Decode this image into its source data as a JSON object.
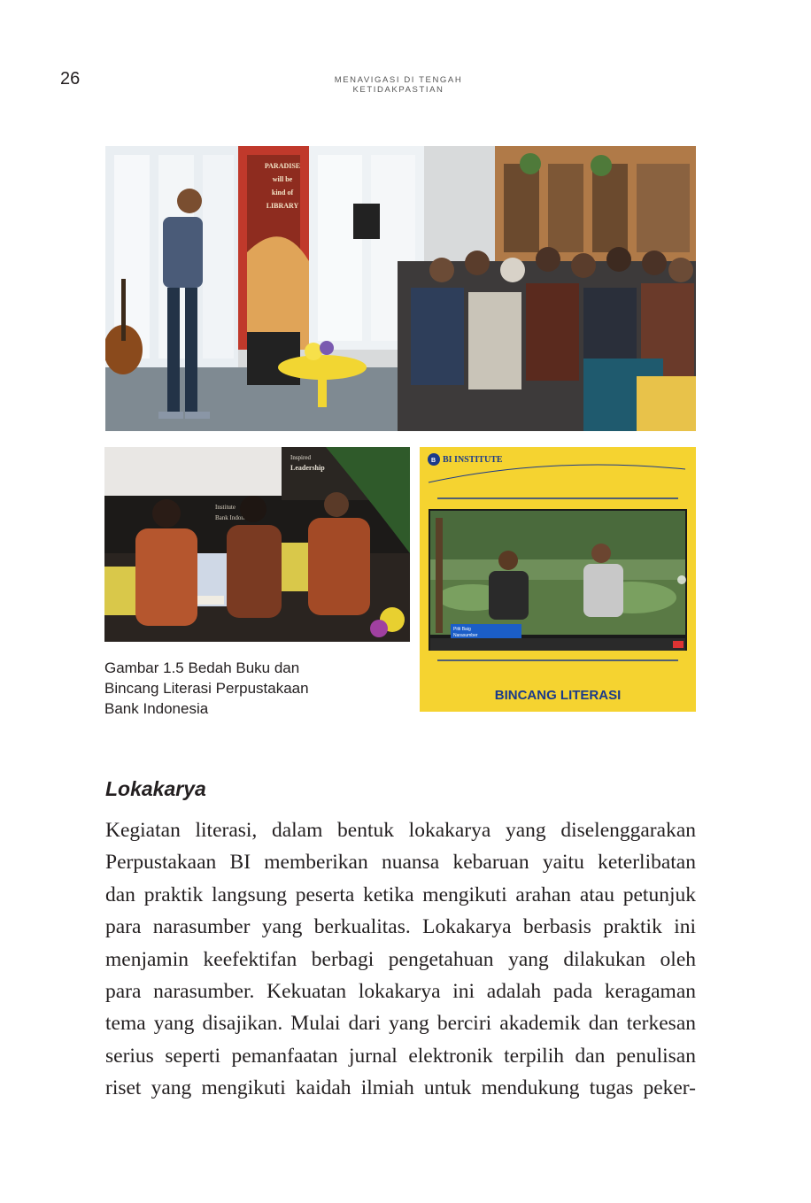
{
  "header": {
    "page_number": "26",
    "running_title": "MENAVIGASI DI TENGAH KETIDAKPASTIAN"
  },
  "photos": {
    "main": {
      "cover_lines": [
        "PARADISE",
        "will be",
        "kind of",
        "LIBRARY"
      ]
    },
    "panel": {
      "backdrop_lines": [
        "Inspired",
        "Leadership"
      ],
      "banner_lines": [
        "Bank Indonesia",
        "Institute"
      ]
    },
    "poster": {
      "brand": "BI INSTITUTE",
      "title": "BINCANG LITERASI",
      "name_tag": [
        "Pitti Baig",
        "Narasumber"
      ]
    }
  },
  "caption": {
    "lines": [
      "Gambar 1.5 Bedah Buku dan",
      "Bincang Literasi Perpustakaan",
      "Bank Indonesia"
    ]
  },
  "section": {
    "heading": "Lokakarya",
    "lines": [
      "Kegiatan literasi, dalam bentuk lokakarya yang diselenggarakan",
      "Perpustakaan BI memberikan nuansa kebaruan yaitu keterlibatan",
      "dan praktik langsung peserta ketika mengikuti arahan atau petunjuk",
      "para narasumber yang berkualitas. Lokakarya berbasis praktik ini",
      "menjamin keefektifan berbagi pengetahuan yang dilakukan oleh",
      "para narasumber. Kekuatan lokakarya ini adalah pada keragaman",
      "tema yang disajikan. Mulai dari yang berciri akademik dan terkesan",
      "serius seperti pemanfaatan jurnal elektronik terpilih dan penulisan",
      "riset yang mengikuti kaidah ilmiah untuk mendukung tugas peker-"
    ]
  }
}
